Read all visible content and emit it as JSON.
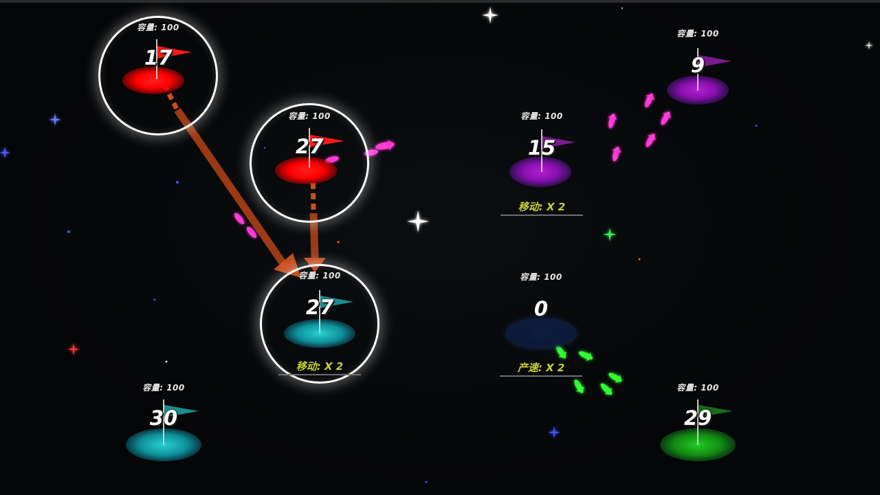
{
  "game": {
    "capacity_label": "容量: 100",
    "nodes": [
      {
        "id": "red-1",
        "owner": "red",
        "count": "17",
        "capacity": "容量: 100",
        "selected": true,
        "bonus": ""
      },
      {
        "id": "red-2",
        "owner": "red",
        "count": "27",
        "capacity": "容量: 100",
        "selected": true,
        "bonus": ""
      },
      {
        "id": "purple-1",
        "owner": "purple",
        "count": "9",
        "capacity": "容量: 100",
        "selected": false,
        "bonus": ""
      },
      {
        "id": "purple-2",
        "owner": "purple",
        "count": "15",
        "capacity": "容量: 100",
        "selected": false,
        "bonus": "移动: X 2"
      },
      {
        "id": "cyan-1",
        "owner": "cyan",
        "count": "27",
        "capacity": "容量: 100",
        "selected": true,
        "bonus": "移动: X 2"
      },
      {
        "id": "neutral-1",
        "owner": "neutral",
        "count": "0",
        "capacity": "容量: 100",
        "selected": false,
        "bonus": "产速: X 2"
      },
      {
        "id": "cyan-2",
        "owner": "cyan",
        "count": "30",
        "capacity": "容量: 100",
        "selected": false,
        "bonus": ""
      },
      {
        "id": "green-1",
        "owner": "green",
        "count": "29",
        "capacity": "容量: 100",
        "selected": false,
        "bonus": ""
      }
    ],
    "colors": {
      "red": "#ff1a1a",
      "purple": "#a020c0",
      "cyan": "#1bb5b5",
      "green": "#22b522",
      "neutral": "#1a3a6a",
      "attack_arrow": "#d8501e",
      "magenta_units": "#ff3ad8",
      "green_units": "#33ff33"
    }
  }
}
